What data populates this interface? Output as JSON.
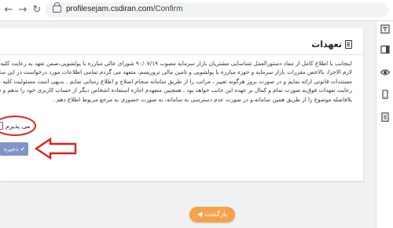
{
  "browser": {
    "url_host": "profilesejam.csdiran.com",
    "url_path": "/Confirm"
  },
  "card": {
    "title": "تعهدات",
    "title_icon": "clipboard-icon",
    "lines": [
      "اینجانب با اطلاع کامل از مفاد دستورالعمل شناسایی مشتریان بازار سرمایه مصوب ۹۰/۰۷/۱۹ شورای عالی مبارزه با پولشویی،ضمن تعهد به رعایت کلیه قوانین و مقررات",
      "لازم الاجرا، بالاخص مقررات بازار سرمایه و حوزه مبارزه با پولشویی و تامین مالی تروریسم، متعهد می گردم تمامی اطلاعات مورد درخواست در این سامانه را مطابق",
      "مستندات قانونی ارائه نمایم و در صورت بروز هرگونه تغییر ، مراتب را از طریق سامانه سجام اصلاح و اطلاع رسانی نمایم . بدیهی است مسئولیت کلیه عواقب ناشی از عدم",
      "رعایت تعهدات فوق‌به صورت تمام و کمال بر عهده این جانب خواهد بود . همچنین متعهدم اجازه استفاده اشخاص دیگر از حساب کاربری خود را ندهم و در صورت اطلاع،",
      "بلافاصله موضوع را از طریق همین سامانه،و در صورت عدم دسترسی به سامانه، به صورت حضوری به مرجع مربوط اطلاع دهم ."
    ],
    "accept_label": "می پذیرم",
    "save_label": "✔ ذخیره"
  },
  "return_button": "بازگشت ◀",
  "annotation_color": "#e02020",
  "sidebar": {
    "icons": [
      "translate-icon",
      "sidebar-panel-icon",
      "eye-icon",
      "mobile-icon",
      "document-icon"
    ]
  }
}
